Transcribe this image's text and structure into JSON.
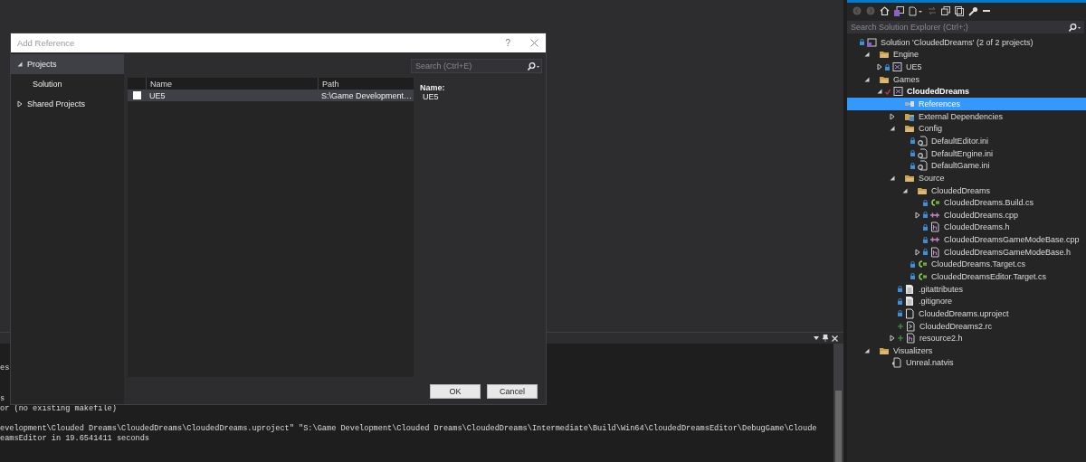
{
  "dialog": {
    "title": "Add Reference",
    "help": "?",
    "nav": [
      {
        "label": "Projects",
        "expanded": true,
        "selected": true,
        "children": [
          {
            "label": "Solution",
            "selected": false
          }
        ]
      },
      {
        "label": "Shared Projects",
        "expanded": false,
        "selected": false
      }
    ],
    "search": {
      "placeholder": "Search (Ctrl+E)"
    },
    "table": {
      "columns": [
        "Name",
        "Path"
      ],
      "rows": [
        {
          "checked": false,
          "selected": true,
          "name": "UE5",
          "path": "S:\\Game Development…"
        }
      ]
    },
    "details": {
      "label": "Name:",
      "value": "UE5"
    },
    "buttons": [
      "OK",
      "Cancel"
    ]
  },
  "output": {
    "lines": [
      {
        "kind": "text",
        "text": "es"
      },
      {
        "kind": "blank"
      },
      {
        "kind": "blank"
      },
      {
        "kind": "text",
        "text": "s"
      },
      {
        "kind": "text",
        "text": "or (no existing makefile)"
      },
      {
        "kind": "blank"
      },
      {
        "kind": "text",
        "text": "evelopment\\Clouded Dreams\\CloudedDreams\\CloudedDreams.uproject\" \"S:\\Game Development\\Clouded Dreams\\CloudedDreams\\Intermediate\\Build\\Win64\\CloudedDreamsEditor\\DebugGame\\Cloude"
      },
      {
        "kind": "text",
        "text": "eamsEditor in 19.6541411 seconds"
      }
    ]
  },
  "solution_explorer": {
    "search": {
      "placeholder": "Search Solution Explorer (Ctrl+;)"
    },
    "tree": [
      {
        "label": "Solution 'CloudedDreams' (2 of 2 projects)",
        "kind": "solution",
        "locked": true,
        "selected": false,
        "children": [
          {
            "label": "Engine",
            "kind": "folder",
            "locked": false,
            "expanded": true,
            "selected": false,
            "children": [
              {
                "label": "UE5",
                "kind": "project",
                "locked": true,
                "expanded": false,
                "selected": false
              }
            ]
          },
          {
            "label": "Games",
            "kind": "folder",
            "locked": false,
            "expanded": true,
            "selected": false,
            "children": [
              {
                "label": "CloudedDreams",
                "kind": "project",
                "locked": false,
                "checked_out": true,
                "startup": true,
                "expanded": true,
                "selected": false,
                "children": [
                  {
                    "label": "References",
                    "kind": "references",
                    "locked": false,
                    "selected": true
                  },
                  {
                    "label": "External Dependencies",
                    "kind": "external",
                    "locked": false,
                    "expanded": false,
                    "selected": false
                  },
                  {
                    "label": "Config",
                    "kind": "folder",
                    "locked": false,
                    "expanded": true,
                    "selected": false,
                    "children": [
                      {
                        "label": "DefaultEditor.ini",
                        "kind": "config",
                        "locked": true,
                        "selected": false
                      },
                      {
                        "label": "DefaultEngine.ini",
                        "kind": "config",
                        "locked": true,
                        "selected": false
                      },
                      {
                        "label": "DefaultGame.ini",
                        "kind": "config",
                        "locked": true,
                        "selected": false
                      }
                    ]
                  },
                  {
                    "label": "Source",
                    "kind": "folder",
                    "locked": false,
                    "expanded": true,
                    "selected": false,
                    "children": [
                      {
                        "label": "CloudedDreams",
                        "kind": "folder",
                        "locked": false,
                        "expanded": true,
                        "selected": false,
                        "children": [
                          {
                            "label": "CloudedDreams.Build.cs",
                            "kind": "csharp",
                            "locked": true,
                            "selected": false
                          },
                          {
                            "label": "CloudedDreams.cpp",
                            "kind": "cpp",
                            "locked": true,
                            "expanded": false,
                            "selected": false
                          },
                          {
                            "label": "CloudedDreams.h",
                            "kind": "header",
                            "locked": true,
                            "selected": false
                          },
                          {
                            "label": "CloudedDreamsGameModeBase.cpp",
                            "kind": "cpp",
                            "locked": true,
                            "selected": false
                          },
                          {
                            "label": "CloudedDreamsGameModeBase.h",
                            "kind": "header",
                            "locked": true,
                            "expanded": false,
                            "selected": false
                          }
                        ]
                      },
                      {
                        "label": "CloudedDreams.Target.cs",
                        "kind": "csharp",
                        "locked": true,
                        "selected": false
                      },
                      {
                        "label": "CloudedDreamsEditor.Target.cs",
                        "kind": "csharp",
                        "locked": true,
                        "selected": false
                      }
                    ]
                  },
                  {
                    "label": ".gitattributes",
                    "kind": "text",
                    "locked": true,
                    "selected": false
                  },
                  {
                    "label": ".gitignore",
                    "kind": "text",
                    "locked": true,
                    "selected": false
                  },
                  {
                    "label": "CloudedDreams.uproject",
                    "kind": "file",
                    "locked": true,
                    "selected": false
                  },
                  {
                    "label": "CloudedDreams2.rc",
                    "kind": "resource",
                    "locked": false,
                    "added": true,
                    "selected": false
                  },
                  {
                    "label": "resource2.h",
                    "kind": "header",
                    "locked": false,
                    "added": true,
                    "expanded": false,
                    "selected": false
                  }
                ]
              }
            ]
          },
          {
            "label": "Visualizers",
            "kind": "folder",
            "locked": false,
            "expanded": true,
            "selected": false,
            "children": [
              {
                "label": "Unreal.natvis",
                "kind": "natvis",
                "locked": false,
                "selected": false
              }
            ]
          }
        ]
      }
    ]
  }
}
